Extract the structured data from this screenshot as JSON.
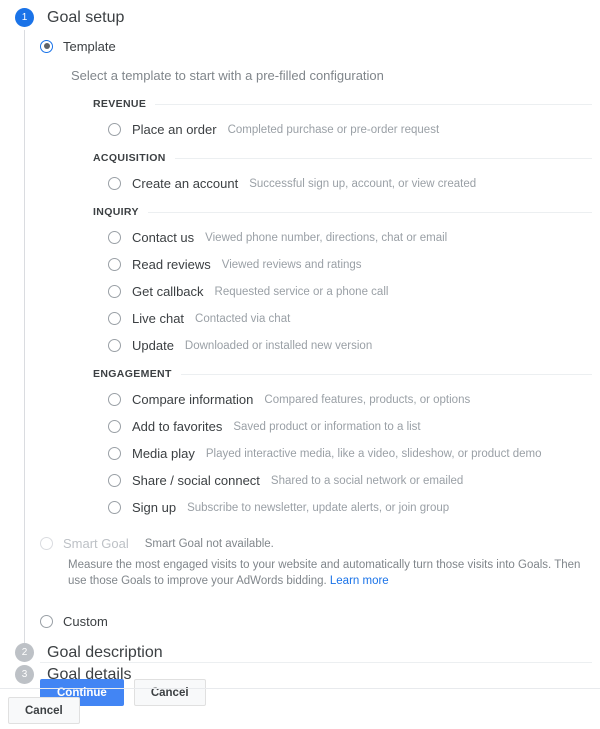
{
  "steps": [
    {
      "number": "1",
      "title": "Goal setup",
      "state": "active"
    },
    {
      "number": "2",
      "title": "Goal description",
      "state": "inactive"
    },
    {
      "number": "3",
      "title": "Goal details",
      "state": "inactive"
    }
  ],
  "goal_setup": {
    "template_option_label": "Template",
    "template_helper_text": "Select a template to start with a pre-filled configuration",
    "custom_option_label": "Custom",
    "groups": [
      {
        "heading": "REVENUE",
        "items": [
          {
            "name": "Place an order",
            "description": "Completed purchase or pre-order request"
          }
        ]
      },
      {
        "heading": "ACQUISITION",
        "items": [
          {
            "name": "Create an account",
            "description": "Successful sign up, account, or view created"
          }
        ]
      },
      {
        "heading": "INQUIRY",
        "items": [
          {
            "name": "Contact us",
            "description": "Viewed phone number, directions, chat or email"
          },
          {
            "name": "Read reviews",
            "description": "Viewed reviews and ratings"
          },
          {
            "name": "Get callback",
            "description": "Requested service or a phone call"
          },
          {
            "name": "Live chat",
            "description": "Contacted via chat"
          },
          {
            "name": "Update",
            "description": "Downloaded or installed new version"
          }
        ]
      },
      {
        "heading": "ENGAGEMENT",
        "items": [
          {
            "name": "Compare information",
            "description": "Compared features, products, or options"
          },
          {
            "name": "Add to favorites",
            "description": "Saved product or information to a list"
          },
          {
            "name": "Media play",
            "description": "Played interactive media, like a video, slideshow, or product demo"
          },
          {
            "name": "Share / social connect",
            "description": "Shared to a social network or emailed"
          },
          {
            "name": "Sign up",
            "description": "Subscribe to newsletter, update alerts, or join group"
          }
        ]
      }
    ],
    "smart_goal": {
      "name": "Smart Goal",
      "status": "Smart Goal not available.",
      "description": "Measure the most engaged visits to your website and automatically turn those visits into Goals. Then use those Goals to improve your AdWords bidding.",
      "learn_more_label": "Learn more"
    },
    "buttons": {
      "continue_label": "Continue",
      "cancel_label": "Cancel"
    }
  },
  "footer": {
    "cancel_label": "Cancel"
  },
  "colors": {
    "accent_blue": "#1a73e8",
    "button_blue": "#4285f4",
    "inactive_gray": "#bdc1c6",
    "muted_text": "#80868b"
  }
}
